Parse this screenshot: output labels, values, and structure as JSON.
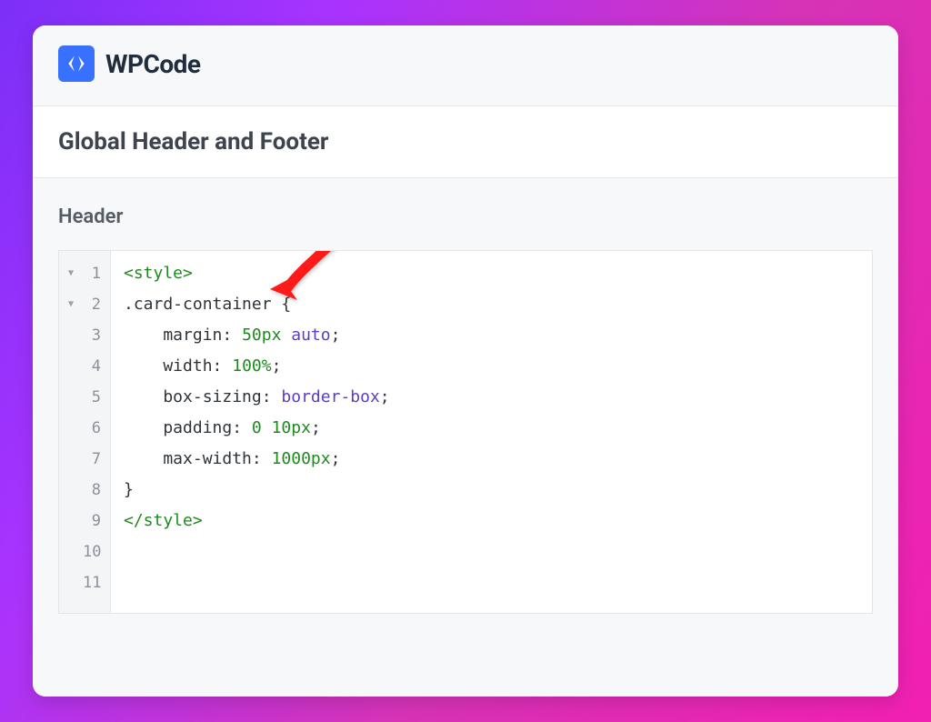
{
  "brand": {
    "name": "WPCode"
  },
  "page": {
    "title": "Global Header and Footer"
  },
  "section": {
    "label": "Header"
  },
  "editor": {
    "lines": [
      {
        "num": "1",
        "fold": "▼",
        "tokens": [
          {
            "cls": "tag",
            "t": "<style>"
          }
        ]
      },
      {
        "num": "2",
        "fold": "▼",
        "tokens": [
          {
            "cls": "selector",
            "t": ".card-container "
          },
          {
            "cls": "brace",
            "t": "{"
          }
        ]
      },
      {
        "num": "3",
        "fold": "",
        "tokens": [
          {
            "cls": "prop",
            "t": "    margin"
          },
          {
            "cls": "punct",
            "t": ": "
          },
          {
            "cls": "value-num",
            "t": "50px "
          },
          {
            "cls": "value-kw",
            "t": "auto"
          },
          {
            "cls": "punct",
            "t": ";"
          }
        ]
      },
      {
        "num": "4",
        "fold": "",
        "tokens": [
          {
            "cls": "prop",
            "t": "    width"
          },
          {
            "cls": "punct",
            "t": ": "
          },
          {
            "cls": "value-num",
            "t": "100%"
          },
          {
            "cls": "punct",
            "t": ";"
          }
        ]
      },
      {
        "num": "5",
        "fold": "",
        "tokens": [
          {
            "cls": "prop",
            "t": "    box-sizing"
          },
          {
            "cls": "punct",
            "t": ": "
          },
          {
            "cls": "value-kw",
            "t": "border-box"
          },
          {
            "cls": "punct",
            "t": ";"
          }
        ]
      },
      {
        "num": "6",
        "fold": "",
        "tokens": [
          {
            "cls": "prop",
            "t": "    padding"
          },
          {
            "cls": "punct",
            "t": ": "
          },
          {
            "cls": "value-num",
            "t": "0 10px"
          },
          {
            "cls": "punct",
            "t": ";"
          }
        ]
      },
      {
        "num": "7",
        "fold": "",
        "tokens": [
          {
            "cls": "prop",
            "t": "    max-width"
          },
          {
            "cls": "punct",
            "t": ": "
          },
          {
            "cls": "value-num",
            "t": "1000px"
          },
          {
            "cls": "punct",
            "t": ";"
          }
        ]
      },
      {
        "num": "8",
        "fold": "",
        "tokens": [
          {
            "cls": "brace",
            "t": "}"
          }
        ]
      },
      {
        "num": "9",
        "fold": "",
        "tokens": [
          {
            "cls": "tag",
            "t": "</style>"
          }
        ]
      },
      {
        "num": "10",
        "fold": "",
        "tokens": []
      },
      {
        "num": "11",
        "fold": "",
        "tokens": []
      }
    ]
  }
}
